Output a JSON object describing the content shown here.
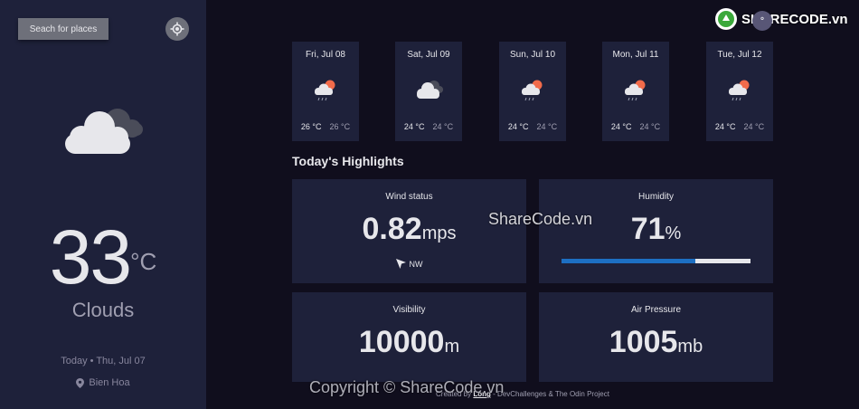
{
  "sidebar": {
    "search_label": "Seach for places",
    "current": {
      "temperature": "33",
      "unit": "°C",
      "condition": "Clouds",
      "date": "Today • Thu, Jul 07",
      "location": "Bien Hoa"
    }
  },
  "watermark": {
    "logo_text": "SHARECODE.vn",
    "middle_text": "ShareCode.vn",
    "bottom_text": "Copyright © ShareCode.vn"
  },
  "forecast": [
    {
      "day": "Fri, Jul 08",
      "max": "26 °C",
      "min": "26 °C",
      "icon": "rain-sun-cloud-icon"
    },
    {
      "day": "Sat, Jul 09",
      "max": "24 °C",
      "min": "24 °C",
      "icon": "cloud-icon"
    },
    {
      "day": "Sun, Jul 10",
      "max": "24 °C",
      "min": "24 °C",
      "icon": "rain-sun-cloud-icon"
    },
    {
      "day": "Mon, Jul 11",
      "max": "24 °C",
      "min": "24 °C",
      "icon": "rain-sun-cloud-icon"
    },
    {
      "day": "Tue, Jul 12",
      "max": "24 °C",
      "min": "24 °C",
      "icon": "rain-sun-cloud-icon"
    }
  ],
  "highlights": {
    "title": "Today's Highlights",
    "wind": {
      "label": "Wind status",
      "value": "0.82",
      "unit": "mps",
      "direction": "NW"
    },
    "humidity": {
      "label": "Humidity",
      "value": "71",
      "unit": "%",
      "percent": 71
    },
    "visibility": {
      "label": "Visibility",
      "value": "10000",
      "unit": "m"
    },
    "pressure": {
      "label": "Air Pressure",
      "value": "1005",
      "unit": "mb"
    }
  },
  "footer": {
    "prefix": "Created by",
    "author": "Long",
    "suffix": "- DevChallenges & The Odin Project"
  },
  "colors": {
    "sidebar_bg": "#1e213a",
    "main_bg": "#100e1d",
    "accent_blue": "#1d6fc2",
    "humidity_track": "#e7e7eb"
  }
}
